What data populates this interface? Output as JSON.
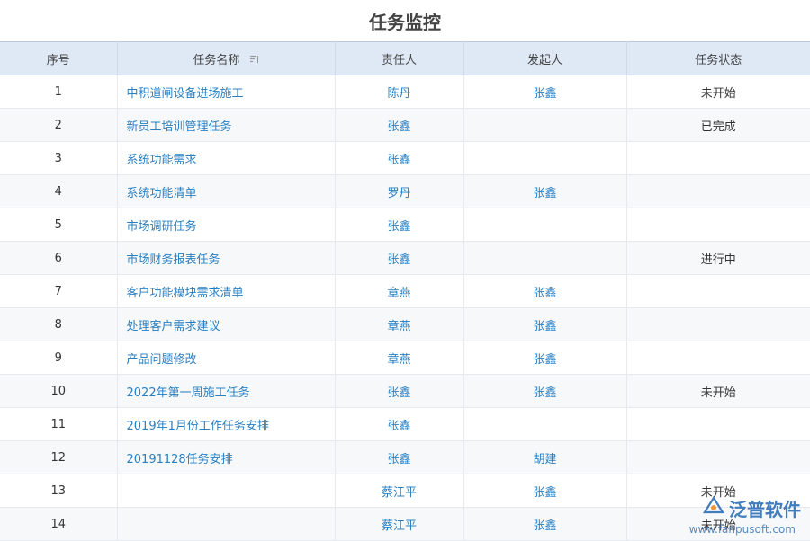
{
  "title": "任务监控",
  "columns": [
    "序号",
    "任务名称",
    "责任人",
    "发起人",
    "任务状态"
  ],
  "rows": [
    {
      "no": "1",
      "name": "中积道闸设备进场施工",
      "owner": "陈丹",
      "initiator": "张鑫",
      "status": "未开始"
    },
    {
      "no": "2",
      "name": "新员工培训管理任务",
      "owner": "张鑫",
      "initiator": "",
      "status": "已完成"
    },
    {
      "no": "3",
      "name": "系统功能需求",
      "owner": "张鑫",
      "initiator": "",
      "status": ""
    },
    {
      "no": "4",
      "name": "系统功能清单",
      "owner": "罗丹",
      "initiator": "张鑫",
      "status": ""
    },
    {
      "no": "5",
      "name": "市场调研任务",
      "owner": "张鑫",
      "initiator": "",
      "status": ""
    },
    {
      "no": "6",
      "name": "市场财务报表任务",
      "owner": "张鑫",
      "initiator": "",
      "status": "进行中"
    },
    {
      "no": "7",
      "name": "客户功能模块需求清单",
      "owner": "章燕",
      "initiator": "张鑫",
      "status": ""
    },
    {
      "no": "8",
      "name": "处理客户需求建议",
      "owner": "章燕",
      "initiator": "张鑫",
      "status": ""
    },
    {
      "no": "9",
      "name": "产品问题修改",
      "owner": "章燕",
      "initiator": "张鑫",
      "status": ""
    },
    {
      "no": "10",
      "name": "2022年第一周施工任务",
      "owner": "张鑫",
      "initiator": "张鑫",
      "status": "未开始"
    },
    {
      "no": "11",
      "name": "2019年1月份工作任务安排",
      "owner": "张鑫",
      "initiator": "",
      "status": ""
    },
    {
      "no": "12",
      "name": "20191128任务安排",
      "owner": "张鑫",
      "initiator": "胡建",
      "status": ""
    },
    {
      "no": "13",
      "name": "",
      "owner": "蔡江平",
      "initiator": "张鑫",
      "status": "未开始"
    },
    {
      "no": "14",
      "name": "",
      "owner": "蔡江平",
      "initiator": "张鑫",
      "status": "未开始"
    }
  ],
  "watermark": {
    "brand": "泛普软件",
    "url": "www.fanpusoft.com"
  }
}
